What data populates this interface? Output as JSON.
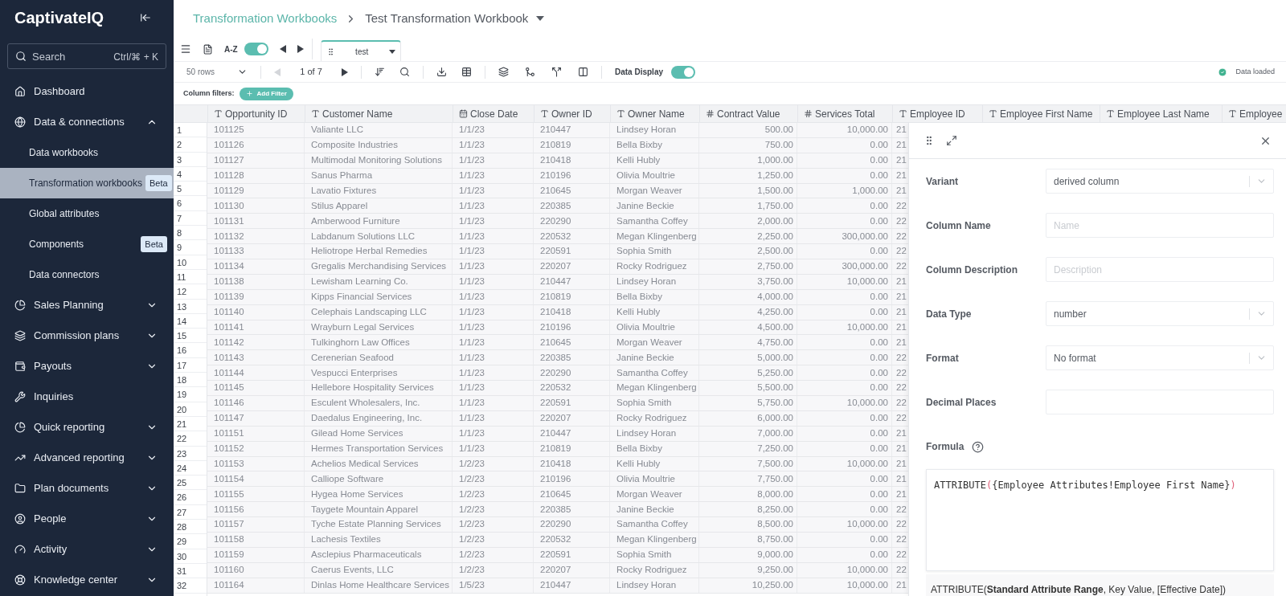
{
  "sidebar": {
    "logo": "CaptivateIQ",
    "search": {
      "placeholder": "Search",
      "shortcut": "Ctrl/⌘ + K"
    },
    "items": [
      {
        "kind": "link",
        "label": "Dashboard"
      },
      {
        "kind": "group",
        "label": "Data & connections",
        "expanded": true,
        "children": [
          {
            "label": "Data workbooks",
            "selected": false
          },
          {
            "label": "Transformation workbooks",
            "selected": true,
            "badge": "Beta"
          },
          {
            "label": "Global attributes",
            "selected": false
          },
          {
            "label": "Components",
            "selected": false,
            "badge": "Beta"
          },
          {
            "label": "Data connectors",
            "selected": false
          }
        ]
      },
      {
        "kind": "group",
        "label": "Sales Planning",
        "expanded": false
      },
      {
        "kind": "group",
        "label": "Commission plans",
        "expanded": false
      },
      {
        "kind": "group",
        "label": "Payouts",
        "expanded": false
      },
      {
        "kind": "link",
        "label": "Inquiries"
      },
      {
        "kind": "group",
        "label": "Quick reporting",
        "expanded": false
      },
      {
        "kind": "group",
        "label": "Advanced reporting",
        "expanded": false
      },
      {
        "kind": "group",
        "label": "Plan documents",
        "expanded": false
      },
      {
        "kind": "group",
        "label": "People",
        "expanded": false
      },
      {
        "kind": "group",
        "label": "Activity",
        "expanded": false
      },
      {
        "kind": "group",
        "label": "Knowledge center",
        "expanded": false
      }
    ]
  },
  "breadcrumb": {
    "parent": "Transformation Workbooks",
    "current": "Test Transformation Workbook"
  },
  "toolbar": {
    "sort_label": "A-Z",
    "sort_toggle_on": true,
    "tabs": [
      {
        "label": "test",
        "selected": true
      }
    ],
    "rows_select": "50 rows",
    "pagination": {
      "text": "1 of 7",
      "prev_disabled": true,
      "next_disabled": false
    },
    "data_display": {
      "label": "Data Display",
      "on": true
    },
    "status": "Data loaded"
  },
  "filters": {
    "label": "Column filters:",
    "add_button": "Add Filter"
  },
  "table": {
    "columns": [
      {
        "kind": "text",
        "label": "Opportunity ID"
      },
      {
        "kind": "text",
        "label": "Customer Name"
      },
      {
        "kind": "date",
        "label": "Close Date"
      },
      {
        "kind": "text",
        "label": "Owner ID"
      },
      {
        "kind": "text",
        "label": "Owner Name"
      },
      {
        "kind": "number",
        "label": "Contract Value"
      },
      {
        "kind": "number",
        "label": "Services Total"
      },
      {
        "kind": "text",
        "label": "Employee ID"
      },
      {
        "kind": "text",
        "label": "Employee First Name"
      },
      {
        "kind": "text",
        "label": "Employee Last Name"
      },
      {
        "kind": "text",
        "label": "Employee"
      }
    ],
    "row_numbers": [
      "1",
      "2",
      "3",
      "4",
      "5",
      "6",
      "7",
      "8",
      "9",
      "10",
      "11",
      "12",
      "13",
      "14",
      "15",
      "16",
      "17",
      "18",
      "19",
      "20",
      "21",
      "22",
      "23",
      "24",
      "25",
      "26",
      "27",
      "28",
      "29",
      "30",
      "31",
      "32"
    ],
    "rows": [
      [
        "101125",
        "Valiante LLC",
        "1/1/23",
        "210447",
        "Lindsey Horan",
        "500.00",
        "10,000.00",
        "21"
      ],
      [
        "101126",
        "Composite Industries",
        "1/1/23",
        "210819",
        "Bella Bixby",
        "750.00",
        "0.00",
        "21"
      ],
      [
        "101127",
        "Multimodal Monitoring Solutions",
        "1/1/23",
        "210418",
        "Kelli Hubly",
        "1,000.00",
        "0.00",
        "21"
      ],
      [
        "101128",
        "Sanus Pharma",
        "1/1/23",
        "210196",
        "Olivia Moultrie",
        "1,250.00",
        "0.00",
        "21"
      ],
      [
        "101129",
        "Lavatio Fixtures",
        "1/1/23",
        "210645",
        "Morgan Weaver",
        "1,500.00",
        "1,000.00",
        "21"
      ],
      [
        "101130",
        "Stilus Apparel",
        "1/1/23",
        "220385",
        "Janine Beckie",
        "1,750.00",
        "0.00",
        "22"
      ],
      [
        "101131",
        "Amberwood Furniture",
        "1/1/23",
        "220290",
        "Samantha Coffey",
        "2,000.00",
        "0.00",
        "22"
      ],
      [
        "101132",
        "Labdanum Solutions LLC",
        "1/1/23",
        "220532",
        "Megan Klingenberg",
        "2,250.00",
        "300,000.00",
        "22"
      ],
      [
        "101133",
        "Heliotrope Herbal Remedies",
        "1/1/23",
        "220591",
        "Sophia Smith",
        "2,500.00",
        "0.00",
        "22"
      ],
      [
        "101134",
        "Gregalis Merchandising Services",
        "1/1/23",
        "220207",
        "Rocky Rodriguez",
        "2,750.00",
        "300,000.00",
        "22"
      ],
      [
        "101138",
        "Lewisham Learning Co.",
        "1/1/23",
        "210447",
        "Lindsey Horan",
        "3,750.00",
        "10,000.00",
        "21"
      ],
      [
        "101139",
        "Kipps Financial Services",
        "1/1/23",
        "210819",
        "Bella Bixby",
        "4,000.00",
        "0.00",
        "21"
      ],
      [
        "101140",
        "Celephais Landscaping LLC",
        "1/1/23",
        "210418",
        "Kelli Hubly",
        "4,250.00",
        "0.00",
        "21"
      ],
      [
        "101141",
        "Wrayburn Legal Services",
        "1/1/23",
        "210196",
        "Olivia Moultrie",
        "4,500.00",
        "10,000.00",
        "21"
      ],
      [
        "101142",
        "Tulkinghorn Law Offices",
        "1/1/23",
        "210645",
        "Morgan Weaver",
        "4,750.00",
        "0.00",
        "21"
      ],
      [
        "101143",
        "Cerenerian Seafood",
        "1/1/23",
        "220385",
        "Janine Beckie",
        "5,000.00",
        "0.00",
        "22"
      ],
      [
        "101144",
        "Vespucci Enterprises",
        "1/1/23",
        "220290",
        "Samantha Coffey",
        "5,250.00",
        "0.00",
        "22"
      ],
      [
        "101145",
        "Hellebore Hospitality Services",
        "1/1/23",
        "220532",
        "Megan Klingenberg",
        "5,500.00",
        "0.00",
        "22"
      ],
      [
        "101146",
        "Esculent Wholesalers, Inc.",
        "1/1/23",
        "220591",
        "Sophia Smith",
        "5,750.00",
        "10,000.00",
        "22"
      ],
      [
        "101147",
        "Daedalus Engineering, Inc.",
        "1/1/23",
        "220207",
        "Rocky Rodriguez",
        "6,000.00",
        "0.00",
        "22"
      ],
      [
        "101151",
        "Gilead Home Services",
        "1/1/23",
        "210447",
        "Lindsey Horan",
        "7,000.00",
        "0.00",
        "21"
      ],
      [
        "101152",
        "Hermes Transportation Services",
        "1/1/23",
        "210819",
        "Bella Bixby",
        "7,250.00",
        "0.00",
        "21"
      ],
      [
        "101153",
        "Achelios Medical Services",
        "1/2/23",
        "210418",
        "Kelli Hubly",
        "7,500.00",
        "10,000.00",
        "21"
      ],
      [
        "101154",
        "Calliope Software",
        "1/2/23",
        "210196",
        "Olivia Moultrie",
        "7,750.00",
        "0.00",
        "21"
      ],
      [
        "101155",
        "Hygea Home Services",
        "1/2/23",
        "210645",
        "Morgan Weaver",
        "8,000.00",
        "0.00",
        "21"
      ],
      [
        "101156",
        "Taygete Mountain Apparel",
        "1/2/23",
        "220385",
        "Janine Beckie",
        "8,250.00",
        "0.00",
        "22"
      ],
      [
        "101157",
        "Tyche Estate Planning Services",
        "1/2/23",
        "220290",
        "Samantha Coffey",
        "8,500.00",
        "10,000.00",
        "22"
      ],
      [
        "101158",
        "Lachesis Textiles",
        "1/2/23",
        "220532",
        "Megan Klingenberg",
        "8,750.00",
        "0.00",
        "22"
      ],
      [
        "101159",
        "Asclepius Pharmaceuticals",
        "1/2/23",
        "220591",
        "Sophia Smith",
        "9,000.00",
        "0.00",
        "22"
      ],
      [
        "101160",
        "Caerus Events, LLC",
        "1/2/23",
        "220207",
        "Rocky Rodriguez",
        "9,250.00",
        "10,000.00",
        "22"
      ],
      [
        "101164",
        "Dinlas Home Healthcare Services",
        "1/5/23",
        "210447",
        "Lindsey Horan",
        "10,250.00",
        "10,000.00",
        "21"
      ]
    ]
  },
  "panel": {
    "fields": [
      {
        "kind": "select",
        "label": "Variant",
        "value": "derived column"
      },
      {
        "kind": "input",
        "label": "Column Name",
        "placeholder": "Name"
      },
      {
        "kind": "input",
        "label": "Column Description",
        "placeholder": "Description"
      },
      {
        "kind": "select",
        "label": "Data Type",
        "value": "number"
      },
      {
        "kind": "select",
        "label": "Format",
        "value": "No format"
      },
      {
        "kind": "input",
        "label": "Decimal Places"
      }
    ],
    "formula": {
      "label": "Formula",
      "tokens": [
        {
          "kind": "plain",
          "text": "ATTRIBUTE"
        },
        {
          "kind": "paren",
          "text": "("
        },
        {
          "kind": "plain",
          "text": "{Employee Attributes!Employee First Name}"
        },
        {
          "kind": "paren",
          "text": ")"
        }
      ],
      "hint": "ATTRIBUTE(**Standard Attribute Range**, Key Value, [Effective Date])"
    }
  }
}
